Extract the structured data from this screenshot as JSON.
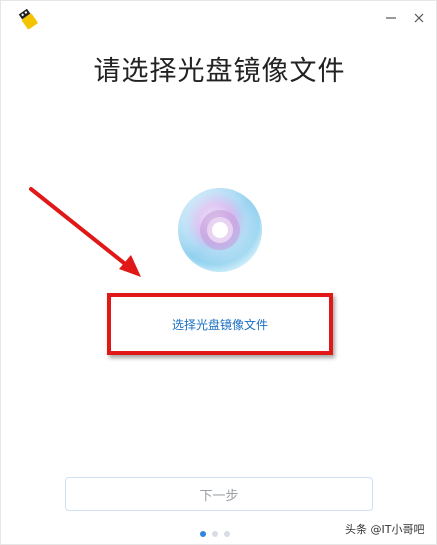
{
  "window": {
    "minimize_symbol": "—",
    "close_symbol": "×",
    "app_icon": "usb-drive-icon"
  },
  "main": {
    "title": "请选择光盘镜像文件",
    "disc_icon": "disc-icon",
    "select_link_label": "选择光盘镜像文件",
    "next_button_label": "下一步"
  },
  "steps": {
    "total": 3,
    "current": 1
  },
  "watermark": {
    "text": "头条 @IT小哥吧"
  },
  "colors": {
    "link": "#1a6fc4",
    "highlight": "#e01818",
    "active_dot": "#2e86de",
    "disabled_text": "#9aa0a6"
  }
}
